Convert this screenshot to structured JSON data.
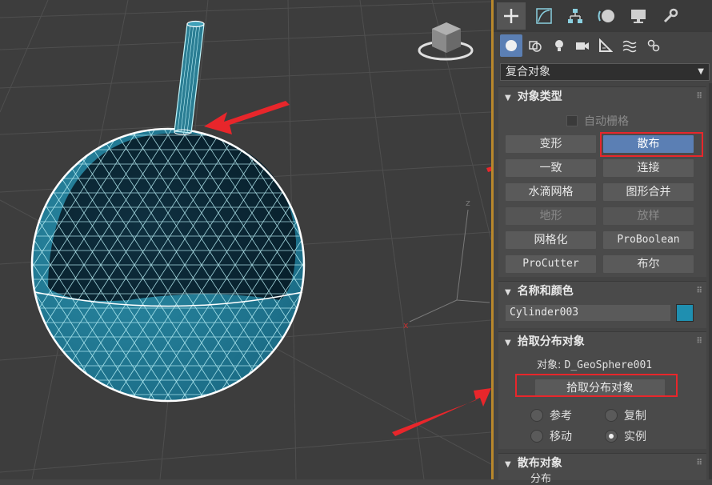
{
  "viewport": {
    "axis_labels": {
      "z": "z",
      "x": "x"
    },
    "colors": {
      "sphere": "#7fe9f7",
      "highlight": "#ffffff",
      "arrow": "#e8262b",
      "grid": "#555555"
    }
  },
  "panel": {
    "tabs": [
      {
        "icon": "create-plus-icon",
        "active": true
      },
      {
        "icon": "modify-curve-icon"
      },
      {
        "icon": "hierarchy-icon"
      },
      {
        "icon": "motion-icon"
      },
      {
        "icon": "display-monitor-icon"
      },
      {
        "icon": "utilities-wrench-icon"
      }
    ],
    "subtabs": [
      {
        "icon": "geometry-sphere-icon",
        "active": true
      },
      {
        "icon": "shapes-icon"
      },
      {
        "icon": "lights-icon"
      },
      {
        "icon": "cameras-icon"
      },
      {
        "icon": "helpers-icon"
      },
      {
        "icon": "space-warps-icon"
      },
      {
        "icon": "systems-icon"
      }
    ],
    "category_dropdown": "复合对象",
    "object_type": {
      "title": "对象类型",
      "autogrid_label": "自动栅格",
      "buttons": {
        "morph": "变形",
        "scatter": "散布",
        "conform": "一致",
        "connect": "连接",
        "blobmesh": "水滴网格",
        "shapemerge": "图形合并",
        "terrain": "地形",
        "loft": "放样",
        "mesher": "网格化",
        "proboolean": "ProBoolean",
        "procutter": "ProCutter",
        "boolean": "布尔"
      }
    },
    "name_color": {
      "title": "名称和颜色",
      "name_value": "Cylinder003",
      "color": "#1f8fb0"
    },
    "pick_distribution": {
      "title": "拾取分布对象",
      "object_label": "对象:",
      "object_value": "D_GeoSphere001",
      "pick_button": "拾取分布对象",
      "radios": {
        "reference": "参考",
        "copy": "复制",
        "move": "移动",
        "instance": "实例"
      },
      "selected": "instance"
    },
    "scatter_objects": {
      "title": "散布对象",
      "sub_label": "分布"
    }
  }
}
